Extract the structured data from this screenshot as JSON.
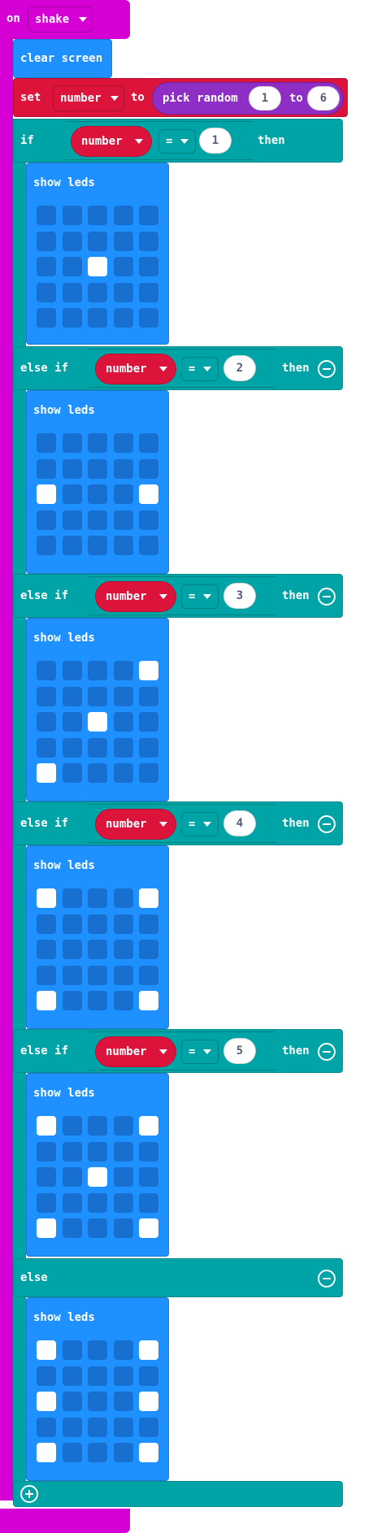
{
  "event": {
    "on_label": "on",
    "gesture": "shake"
  },
  "clear_label": "clear screen",
  "set_block": {
    "set_label": "set",
    "variable": "number",
    "to_label": "to",
    "random_label": "pick random",
    "from": "1",
    "to_sep": "to",
    "max": "6"
  },
  "if_label": "if",
  "else_if_label": "else if",
  "else_label": "else",
  "then_label": "then",
  "show_leds_label": "show leds",
  "operator": "=",
  "branches": [
    {
      "value": "1",
      "leds": [
        [
          0,
          0,
          0,
          0,
          0
        ],
        [
          0,
          0,
          0,
          0,
          0
        ],
        [
          0,
          0,
          1,
          0,
          0
        ],
        [
          0,
          0,
          0,
          0,
          0
        ],
        [
          0,
          0,
          0,
          0,
          0
        ]
      ]
    },
    {
      "value": "2",
      "leds": [
        [
          0,
          0,
          0,
          0,
          0
        ],
        [
          0,
          0,
          0,
          0,
          0
        ],
        [
          1,
          0,
          0,
          0,
          1
        ],
        [
          0,
          0,
          0,
          0,
          0
        ],
        [
          0,
          0,
          0,
          0,
          0
        ]
      ]
    },
    {
      "value": "3",
      "leds": [
        [
          0,
          0,
          0,
          0,
          1
        ],
        [
          0,
          0,
          0,
          0,
          0
        ],
        [
          0,
          0,
          1,
          0,
          0
        ],
        [
          0,
          0,
          0,
          0,
          0
        ],
        [
          1,
          0,
          0,
          0,
          0
        ]
      ]
    },
    {
      "value": "4",
      "leds": [
        [
          1,
          0,
          0,
          0,
          1
        ],
        [
          0,
          0,
          0,
          0,
          0
        ],
        [
          0,
          0,
          0,
          0,
          0
        ],
        [
          0,
          0,
          0,
          0,
          0
        ],
        [
          1,
          0,
          0,
          0,
          1
        ]
      ]
    },
    {
      "value": "5",
      "leds": [
        [
          1,
          0,
          0,
          0,
          1
        ],
        [
          0,
          0,
          0,
          0,
          0
        ],
        [
          0,
          0,
          1,
          0,
          0
        ],
        [
          0,
          0,
          0,
          0,
          0
        ],
        [
          1,
          0,
          0,
          0,
          1
        ]
      ]
    }
  ],
  "else_leds": [
    [
      1,
      0,
      0,
      0,
      1
    ],
    [
      0,
      0,
      0,
      0,
      0
    ],
    [
      1,
      0,
      0,
      0,
      1
    ],
    [
      0,
      0,
      0,
      0,
      0
    ],
    [
      1,
      0,
      0,
      0,
      1
    ]
  ],
  "colors": {
    "event": "#d400d4",
    "basic": "#1e90ff",
    "variable": "#dc143c",
    "logic": "#00a4a6",
    "math": "#8e2ec4"
  }
}
